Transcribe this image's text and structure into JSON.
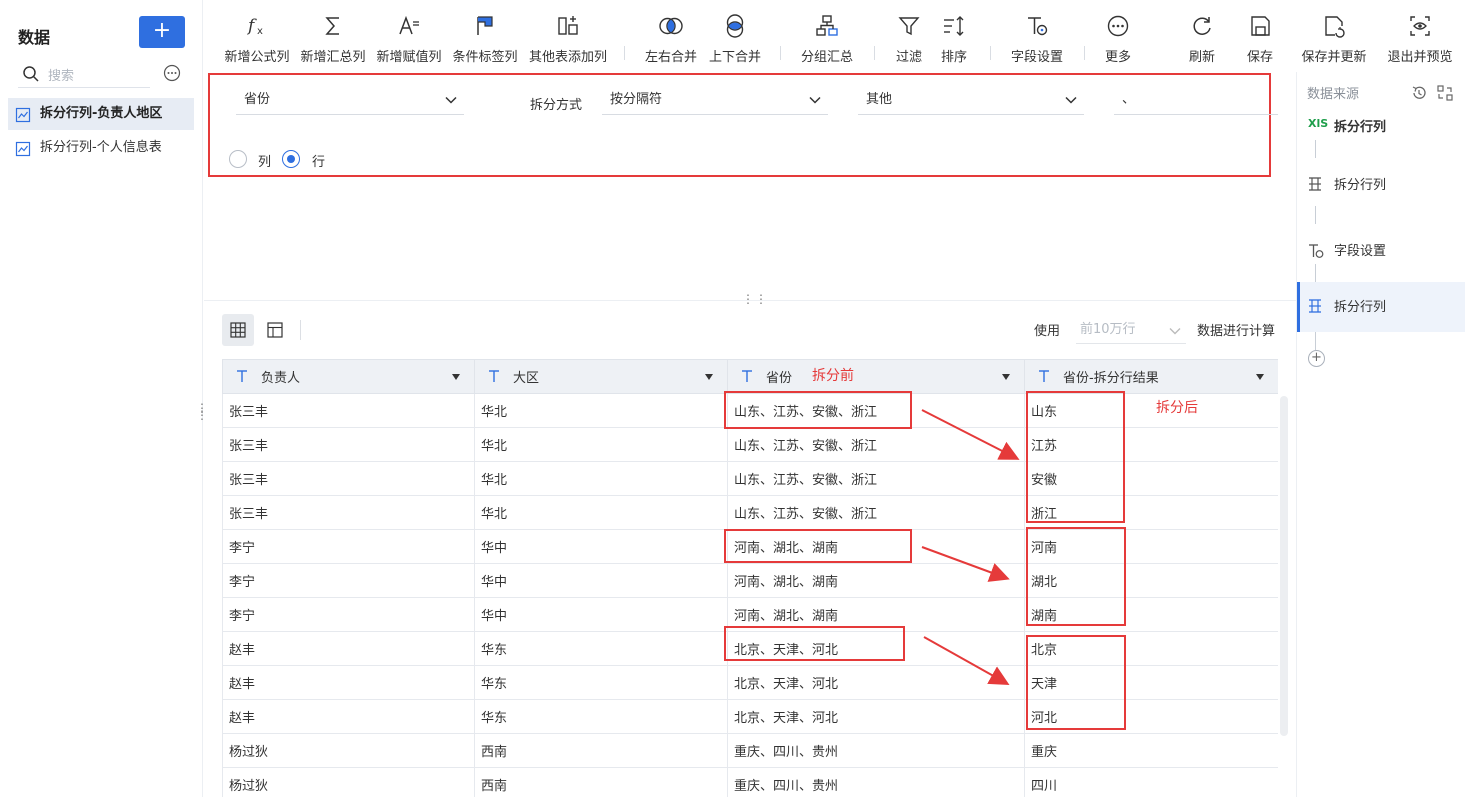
{
  "sidebar": {
    "title": "数据",
    "add_label": "+",
    "search_placeholder": "搜索",
    "items": [
      {
        "label": "拆分行列-负责人地区"
      },
      {
        "label": "拆分行列-个人信息表"
      }
    ]
  },
  "toolbar": {
    "items": [
      {
        "label": "新增公式列",
        "icon": "function-icon"
      },
      {
        "label": "新增汇总列",
        "icon": "sigma-icon"
      },
      {
        "label": "新增赋值列",
        "icon": "assign-icon"
      },
      {
        "label": "条件标签列",
        "icon": "flag-icon"
      },
      {
        "label": "其他表添加列",
        "icon": "add-column-icon"
      },
      {
        "label": "左右合并",
        "icon": "merge-lr-icon"
      },
      {
        "label": "上下合并",
        "icon": "merge-ud-icon"
      },
      {
        "label": "分组汇总",
        "icon": "group-icon"
      },
      {
        "label": "过滤",
        "icon": "filter-icon"
      },
      {
        "label": "排序",
        "icon": "sort-icon"
      },
      {
        "label": "字段设置",
        "icon": "field-settings-icon"
      },
      {
        "label": "更多",
        "icon": "more-icon"
      },
      {
        "label": "刷新",
        "icon": "refresh-icon"
      },
      {
        "label": "保存",
        "icon": "save-icon"
      },
      {
        "label": "保存并更新",
        "icon": "save-update-icon"
      },
      {
        "label": "退出并预览",
        "icon": "preview-icon"
      }
    ]
  },
  "config": {
    "field_value": "省份",
    "split_label": "拆分方式",
    "split_value": "按分隔符",
    "delimiter_type": "其他",
    "delimiter_value": "、",
    "radio_col": "列",
    "radio_row": "行",
    "selected": "行"
  },
  "right_panel": {
    "title": "数据来源",
    "steps": [
      {
        "label": "拆分行列",
        "icon": "xls-icon"
      },
      {
        "label": "拆分行列",
        "icon": "split-icon"
      },
      {
        "label": "字段设置",
        "icon": "field-settings-icon"
      },
      {
        "label": "拆分行列",
        "icon": "split-icon"
      }
    ],
    "xls_badge": "XlS"
  },
  "table_controls": {
    "use_label": "使用",
    "rows_value": "前10万行",
    "calc_label": "数据进行计算"
  },
  "table": {
    "columns": [
      "负责人",
      "大区",
      "省份",
      "省份-拆分行结果"
    ],
    "rows": [
      [
        "张三丰",
        "华北",
        "山东、江苏、安徽、浙江",
        "山东"
      ],
      [
        "张三丰",
        "华北",
        "山东、江苏、安徽、浙江",
        "江苏"
      ],
      [
        "张三丰",
        "华北",
        "山东、江苏、安徽、浙江",
        "安徽"
      ],
      [
        "张三丰",
        "华北",
        "山东、江苏、安徽、浙江",
        "浙江"
      ],
      [
        "李宁",
        "华中",
        "河南、湖北、湖南",
        "河南"
      ],
      [
        "李宁",
        "华中",
        "河南、湖北、湖南",
        "湖北"
      ],
      [
        "李宁",
        "华中",
        "河南、湖北、湖南",
        "湖南"
      ],
      [
        "赵丰",
        "华东",
        "北京、天津、河北",
        "北京"
      ],
      [
        "赵丰",
        "华东",
        "北京、天津、河北",
        "天津"
      ],
      [
        "赵丰",
        "华东",
        "北京、天津、河北",
        "河北"
      ],
      [
        "杨过狄",
        "西南",
        "重庆、四川、贵州",
        "重庆"
      ],
      [
        "杨过狄",
        "西南",
        "重庆、四川、贵州",
        "四川"
      ]
    ]
  },
  "annotations": {
    "before": "拆分前",
    "after": "拆分后",
    "color": "#e53a3a"
  },
  "colors": {
    "accent": "#2f6fe0",
    "annotation": "#e53a3a",
    "xls_green": "#1e9e4a"
  }
}
